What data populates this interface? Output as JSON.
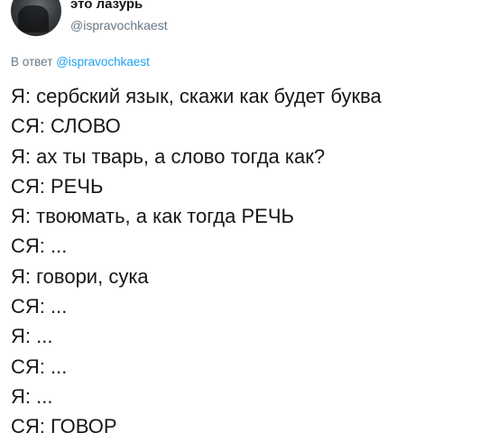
{
  "tweet": {
    "display_name": "это лазурь",
    "username": "@ispravochkaest",
    "reply_prefix": "В ответ",
    "reply_to": "@ispravochkaest",
    "lines": [
      "Я: сербский язык, скажи как будет буква",
      "СЯ: СЛОВО",
      "Я: ах ты тварь, а слово тогда как?",
      "СЯ: РЕЧЬ",
      "Я: твоюмать, а как тогда РЕЧЬ",
      "СЯ: ...",
      "Я: говори, сука",
      "СЯ: ...",
      "Я: ...",
      "СЯ: ...",
      "Я: ...",
      "СЯ: ГОВОР"
    ]
  }
}
